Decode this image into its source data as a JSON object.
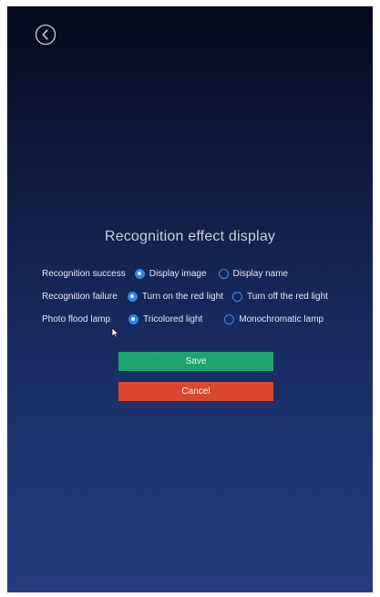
{
  "screen": {
    "back_icon": "chevron-left-circle-icon",
    "title": "Recognition effect display"
  },
  "options": [
    {
      "label": "Recognition success",
      "choices": [
        {
          "label": "Display image",
          "selected": true
        },
        {
          "label": "Display name",
          "selected": false
        }
      ]
    },
    {
      "label": "Recognition failure",
      "choices": [
        {
          "label": "Turn on the red light",
          "selected": true
        },
        {
          "label": "Turn off the red light",
          "selected": false
        }
      ]
    },
    {
      "label": "Photo flood lamp",
      "choices": [
        {
          "label": "Tricolored light",
          "selected": true
        },
        {
          "label": "Monochromatic lamp",
          "selected": false
        }
      ]
    }
  ],
  "buttons": {
    "save_label": "Save",
    "cancel_label": "Cancel"
  },
  "colors": {
    "accent_radio": "#2f86e8",
    "save": "#1ea56d",
    "cancel": "#d9482f"
  }
}
